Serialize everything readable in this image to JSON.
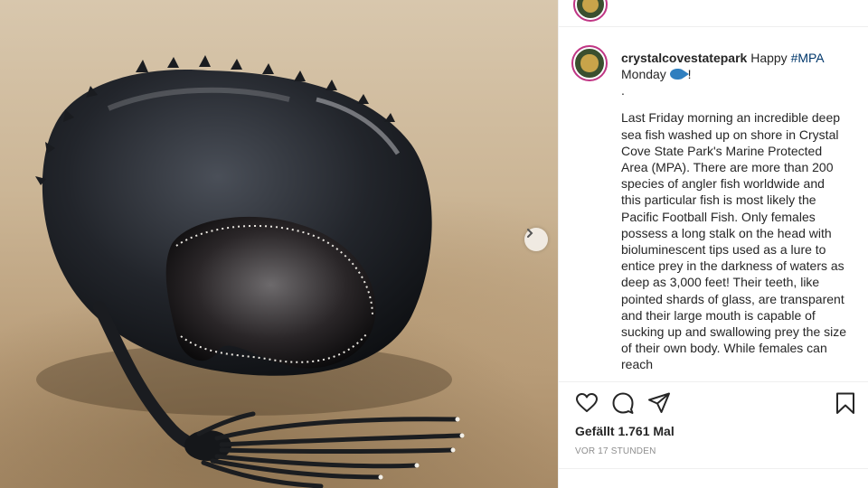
{
  "post": {
    "username": "crystalcovestatepark",
    "caption_intro": "Happy",
    "hashtag": "#MPA",
    "caption_intro_2": "Monday",
    "caption_excl": "!",
    "caption_dot": ".",
    "caption_body": "Last Friday morning an incredible deep sea fish washed up on shore in Crystal Cove State Park's Marine Protected Area (MPA). There are more than 200 species of angler fish worldwide and this particular fish is most likely the Pacific Football Fish. Only females possess a long stalk on the head with bioluminescent tips used as a lure to entice prey in the darkness of waters as deep as 3,000 feet! Their teeth, like pointed shards of glass, are transparent and their large mouth is capable of sucking up and swallowing prey the size of their own body. While females can reach",
    "likes": "Gefällt 1.761 Mal",
    "timestamp": "VOR 17 STUNDEN"
  },
  "icons": {
    "like": "heart-icon",
    "comment": "comment-icon",
    "share": "paper-plane-icon",
    "save": "bookmark-icon",
    "next": "chevron-right-icon",
    "emoji": "fish-emoji-icon"
  },
  "colors": {
    "text": "#262626",
    "hashtag": "#00376b",
    "muted": "#8e8e8e",
    "divider": "#efefef"
  }
}
